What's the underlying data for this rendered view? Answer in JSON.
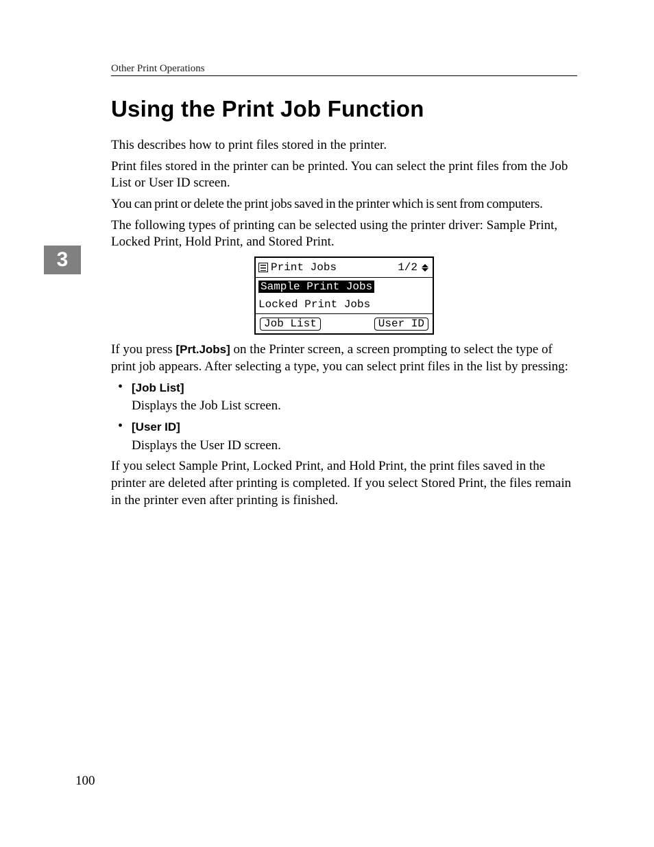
{
  "header": {
    "running_head": "Other Print Operations"
  },
  "chapter_tab": "3",
  "title": "Using the Print Job Function",
  "paragraphs": {
    "p1": "This describes how to print files stored in the printer.",
    "p2": "Print files stored in the printer can be printed. You can select the print files from the Job List or User ID screen.",
    "p3": "You can print or delete the print jobs saved in the printer which is sent from computers.",
    "p4": "The following types of printing can be selected using the printer driver: Sample Print, Locked Print, Hold Print, and Stored Print."
  },
  "lcd": {
    "title": "Print Jobs",
    "pager": "1/2",
    "items": [
      "Sample Print Jobs",
      "Locked Print Jobs"
    ],
    "selected_index": 0,
    "buttons": {
      "left": "Job List",
      "right": "User ID"
    }
  },
  "after_lcd": {
    "lead_pre": "If you press ",
    "btn": "[Prt.Jobs]",
    "lead_post": " on the Printer screen, a screen prompting to select the type of print job appears. After selecting a type, you can select print files in the list by pressing:"
  },
  "options": [
    {
      "label": "[Job List]",
      "desc": "Displays the Job List screen."
    },
    {
      "label": "[User ID]",
      "desc": "Displays the User ID screen."
    }
  ],
  "closing": "If you select Sample Print, Locked Print, and Hold Print, the print files saved in the printer are deleted after printing is completed. If you select Stored Print, the files remain in the printer even after printing is finished.",
  "page_number": "100"
}
